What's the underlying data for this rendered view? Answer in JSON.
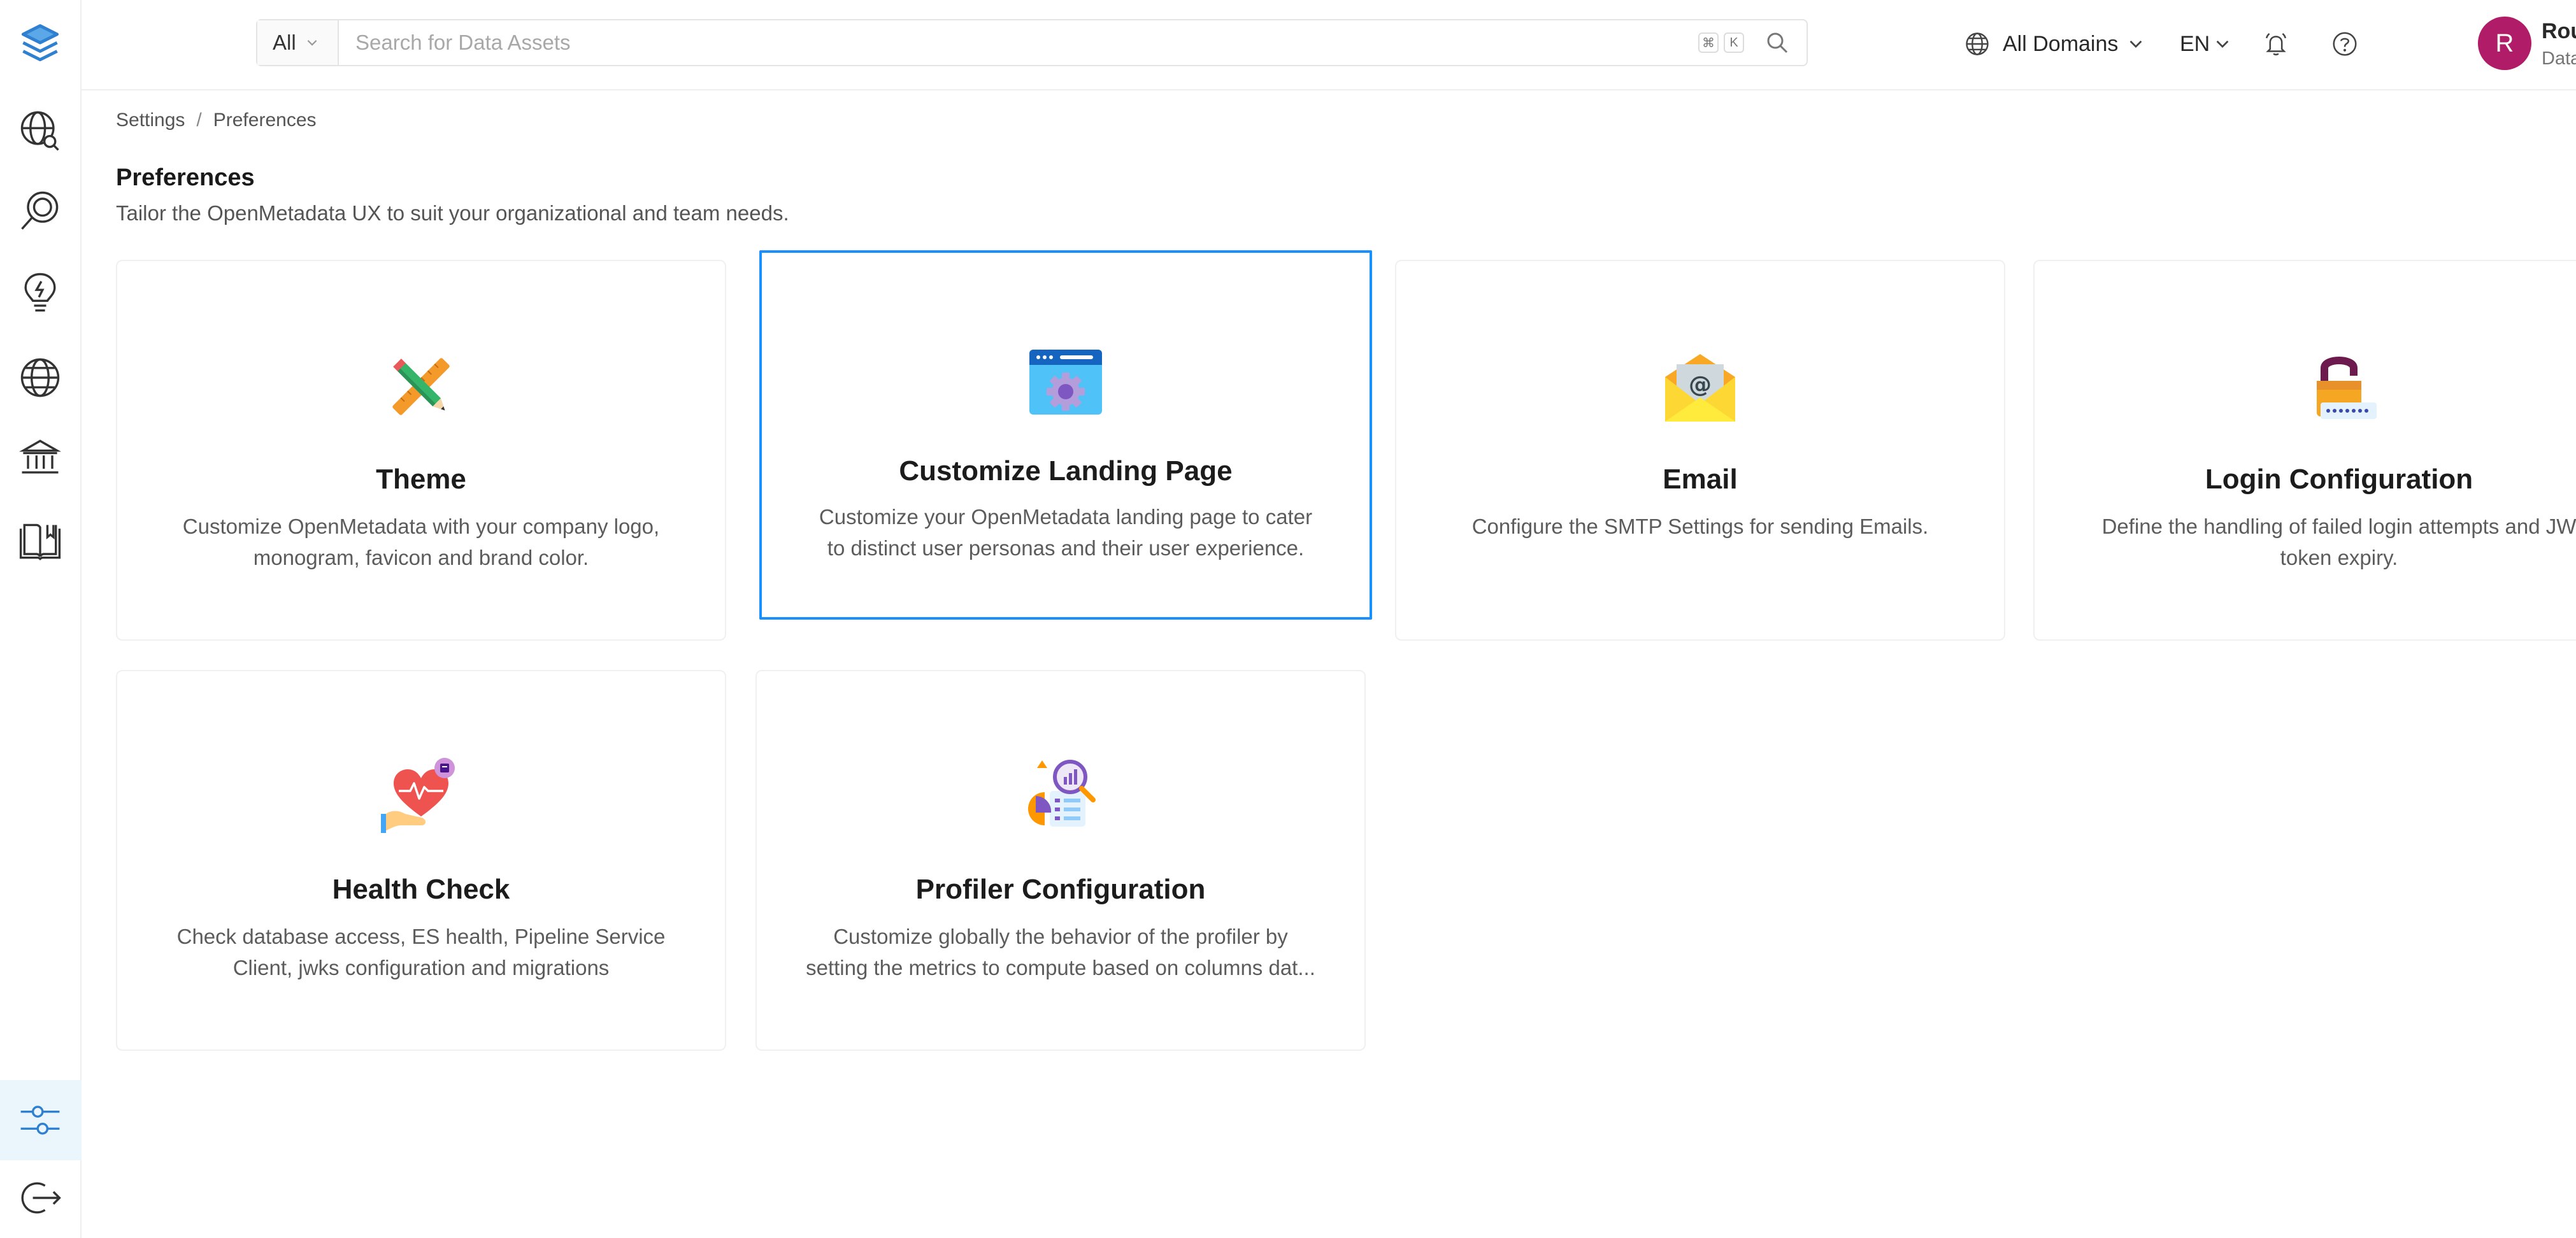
{
  "header": {
    "search": {
      "scope": "All",
      "placeholder": "Search for Data Assets",
      "shortcut": [
        "⌘",
        "K"
      ]
    },
    "domain_selector": "All Domains",
    "language": "EN",
    "user": {
      "initial": "R",
      "name": "Rounakpree",
      "role": "Data Steward"
    }
  },
  "breadcrumb": [
    "Settings",
    "Preferences"
  ],
  "page": {
    "title": "Preferences",
    "subtitle": "Tailor the OpenMetadata UX to suit your organizational and team needs."
  },
  "cards": [
    {
      "icon": "pencil-ruler-icon",
      "title": "Theme",
      "desc1": "Customize OpenMetadata with your company logo,",
      "desc2": "monogram, favicon and brand color."
    },
    {
      "icon": "browser-gear-icon",
      "title": "Customize Landing Page",
      "desc1": "Customize your OpenMetadata landing page to cater",
      "desc2": "to distinct user personas and their user experience."
    },
    {
      "icon": "email-envelope-icon",
      "title": "Email",
      "desc1": "Configure the SMTP Settings for sending Emails.",
      "desc2": ""
    },
    {
      "icon": "padlock-password-icon",
      "title": "Login Configuration",
      "desc1": "Define the handling of failed login attempts and JW",
      "desc2": "token expiry."
    },
    {
      "icon": "heart-hand-icon",
      "title": "Health Check",
      "desc1": "Check database access, ES health, Pipeline Service",
      "desc2": "Client, jwks configuration and migrations"
    },
    {
      "icon": "chart-magnifier-icon",
      "title": "Profiler Configuration",
      "desc1": "Customize globally the behavior of the profiler by",
      "desc2": "setting the metrics to compute based on columns dat..."
    }
  ],
  "colors": {
    "accent": "#1890ff",
    "avatar": "#b01c67",
    "sidebar_active": "#eaf5fc"
  }
}
